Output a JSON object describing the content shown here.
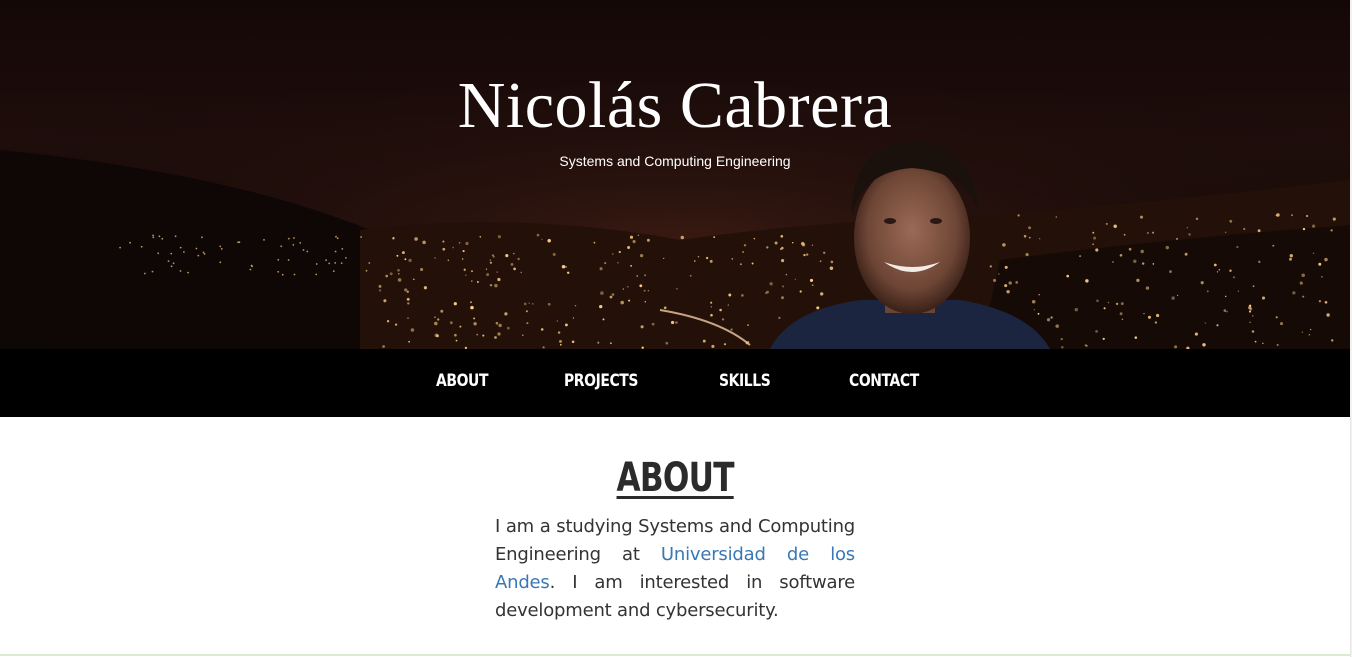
{
  "hero": {
    "title": "Nicolás Cabrera",
    "subtitle": "Systems and Computing Engineering",
    "image": "night city panorama with portrait"
  },
  "nav": {
    "items": [
      {
        "label": "ABOUT"
      },
      {
        "label": "PROJECTS"
      },
      {
        "label": "SKILLS"
      },
      {
        "label": "CONTACT"
      }
    ]
  },
  "about": {
    "heading": "ABOUT",
    "text_before": "I am a studying Systems and Computing Engineering at ",
    "link_text": "Universidad de los Andes",
    "text_after": ". I am interested in software development and cybersecurity."
  },
  "colors": {
    "nav_bg": "#000000",
    "link": "#3a78b5",
    "heading": "#2b2b2b"
  }
}
